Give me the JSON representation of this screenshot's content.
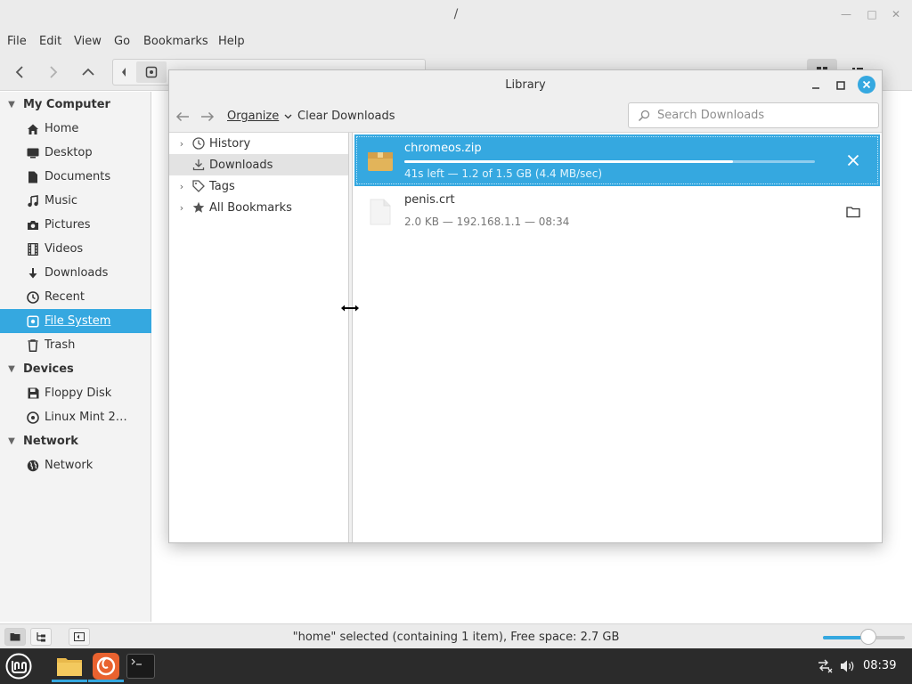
{
  "file_manager": {
    "title": "/",
    "menu": [
      "File",
      "Edit",
      "View",
      "Go",
      "Bookmarks",
      "Help"
    ],
    "sidebar": {
      "sections": [
        {
          "label": "My Computer",
          "items": [
            {
              "label": "Home",
              "icon": "home-icon"
            },
            {
              "label": "Desktop",
              "icon": "desktop-icon"
            },
            {
              "label": "Documents",
              "icon": "documents-icon"
            },
            {
              "label": "Music",
              "icon": "music-icon"
            },
            {
              "label": "Pictures",
              "icon": "camera-icon"
            },
            {
              "label": "Videos",
              "icon": "film-icon"
            },
            {
              "label": "Downloads",
              "icon": "download-arrow-icon"
            },
            {
              "label": "Recent",
              "icon": "clock-icon"
            },
            {
              "label": "File System",
              "icon": "drive-icon",
              "selected": true
            },
            {
              "label": "Trash",
              "icon": "trash-icon"
            }
          ]
        },
        {
          "label": "Devices",
          "items": [
            {
              "label": "Floppy Disk",
              "icon": "floppy-icon"
            },
            {
              "label": "Linux Mint 2…",
              "icon": "disc-icon"
            }
          ]
        },
        {
          "label": "Network",
          "items": [
            {
              "label": "Network",
              "icon": "globe-icon"
            }
          ]
        }
      ]
    },
    "status": "\"home\" selected (containing 1 item), Free space: 2.7 GB",
    "zoom_level": 0.55
  },
  "library": {
    "title": "Library",
    "toolbar": {
      "organize": "Organize",
      "clear": "Clear Downloads",
      "search_placeholder": "Search Downloads"
    },
    "tree": [
      {
        "label": "History",
        "icon": "clock-icon",
        "expandable": true
      },
      {
        "label": "Downloads",
        "icon": "download-icon",
        "expandable": false,
        "selected": true
      },
      {
        "label": "Tags",
        "icon": "tag-icon",
        "expandable": true
      },
      {
        "label": "All Bookmarks",
        "icon": "star-icon",
        "expandable": true
      }
    ],
    "downloads": [
      {
        "name": "chromeos.zip",
        "meta": "41s left — 1.2 of 1.5 GB (4.4 MB/sec)",
        "progress": 0.8,
        "in_progress": true,
        "icon": "archive-icon",
        "action": "cancel-icon"
      },
      {
        "name": "penis.crt",
        "meta": "2.0 KB — 192.168.1.1 — 08:34",
        "in_progress": false,
        "icon": "file-icon",
        "action": "folder-icon"
      }
    ]
  },
  "taskbar": {
    "clock": "08:39"
  },
  "colors": {
    "accent": "#35a8e0",
    "archive_icon": "#e2b45a",
    "taskbar_bg": "#2b2b2b",
    "firefox_bg": "#e9622f"
  }
}
